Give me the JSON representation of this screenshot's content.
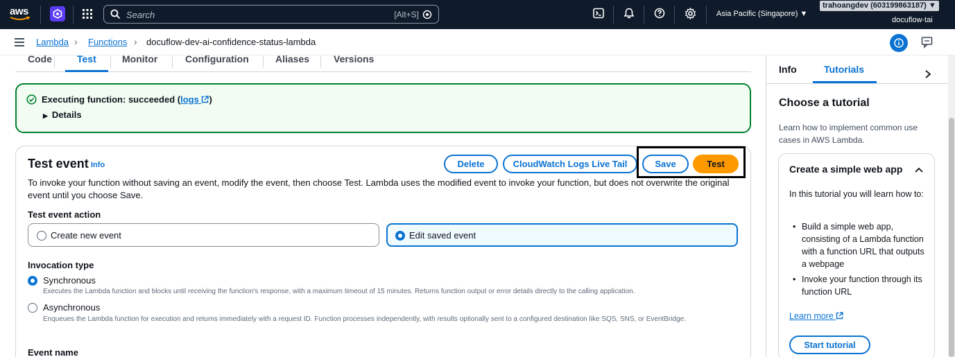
{
  "topnav": {
    "logo_text": "aws",
    "search_placeholder": "Search",
    "search_shortcut": "[Alt+S]",
    "region": "Asia Pacific (Singapore) ▼",
    "account": "trahoangdev (603199863187) ▼",
    "account_sub": "docuflow-tai"
  },
  "breadcrumb": {
    "items": [
      "Lambda",
      "Functions"
    ],
    "current": "docuflow-dev-ai-confidence-status-lambda"
  },
  "tabs": [
    "Code",
    "Test",
    "Monitor",
    "Configuration",
    "Aliases",
    "Versions"
  ],
  "active_tab": "Test",
  "alert": {
    "message_prefix": "Executing function: succeeded (",
    "logs_link": "logs",
    "message_suffix": ")",
    "details": "Details"
  },
  "test_event": {
    "title": "Test event",
    "info": "Info",
    "buttons": {
      "delete": "Delete",
      "cloudwatch": "CloudWatch Logs Live Tail",
      "save": "Save",
      "test": "Test"
    },
    "description": "To invoke your function without saving an event, modify the event, then choose Test. Lambda uses the modified event to invoke your function, but does not overwrite the original event until you choose Save.",
    "action_label": "Test event action",
    "action_options": [
      "Create new event",
      "Edit saved event"
    ],
    "invocation_label": "Invocation type",
    "sync_title": "Synchronous",
    "sync_desc": "Executes the Lambda function and blocks until receiving the function's response, with a maximum timeout of 15 minutes. Returns function output or error details directly to the calling application.",
    "async_title": "Asynchronous",
    "async_desc": "Enqueues the Lambda function for execution and returns immediately with a request ID. Function processes independently, with results optionally sent to a configured destination like SQS, SNS, or EventBridge.",
    "event_name_label": "Event name"
  },
  "right_panel": {
    "tabs": [
      "Info",
      "Tutorials"
    ],
    "heading": "Choose a tutorial",
    "intro": "Learn how to implement common use cases in AWS Lambda.",
    "card_title": "Create a simple web app",
    "card_intro": "In this tutorial you will learn how to:",
    "bullets": [
      "Build a simple web app, consisting of a Lambda function with a function URL that outputs a webpage",
      "Invoke your function through its function URL"
    ],
    "learn_more": "Learn more",
    "start": "Start tutorial"
  },
  "colors": {
    "nav_bg": "#0f1b2a",
    "accent": "#0972d3",
    "success": "#00802f",
    "primary_button": "#ff9900"
  }
}
